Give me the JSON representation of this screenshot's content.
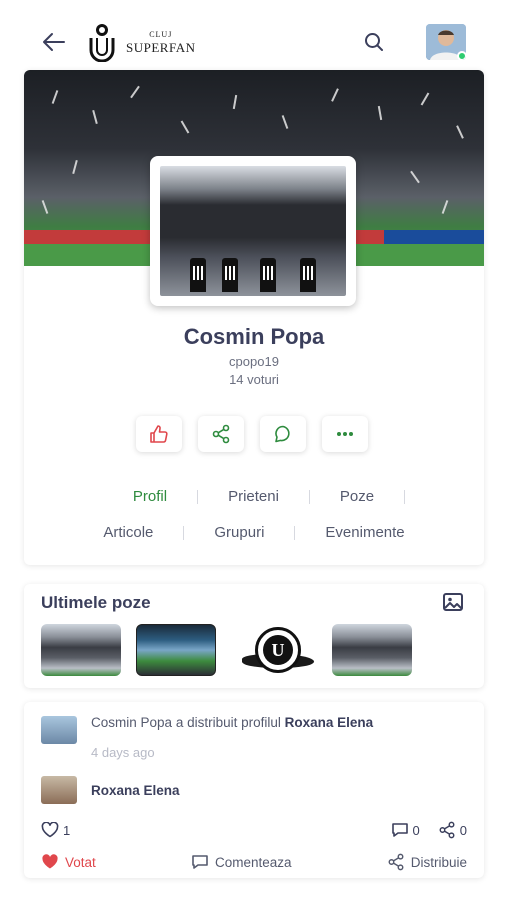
{
  "header": {
    "logo_club": "CLUJ",
    "logo_text": "SUPERFAN"
  },
  "profile": {
    "name": "Cosmin Popa",
    "username": "cpopo19",
    "votes": "14 voturi",
    "tabs_row1": [
      "Profil",
      "Prieteni",
      "Poze"
    ],
    "tabs_row2": [
      "Articole",
      "Grupuri",
      "Evenimente"
    ],
    "active_tab": "Profil"
  },
  "photos": {
    "title": "Ultimele poze",
    "crest_letter": "U"
  },
  "post": {
    "author": "Cosmin Popa",
    "action": "a distribuit profilul",
    "target": "Roxana Elena",
    "time": "4 days ago",
    "shared_name": "Roxana Elena",
    "likes": "1",
    "comments": "0",
    "shares": "0",
    "vote_label": "Votat",
    "comment_label": "Comenteaza",
    "share_label": "Distribuie"
  },
  "colors": {
    "accent_green": "#2e8b3e",
    "like_red": "#e0474c",
    "text_dark": "#3b3f5c",
    "online": "#2ecc71"
  }
}
